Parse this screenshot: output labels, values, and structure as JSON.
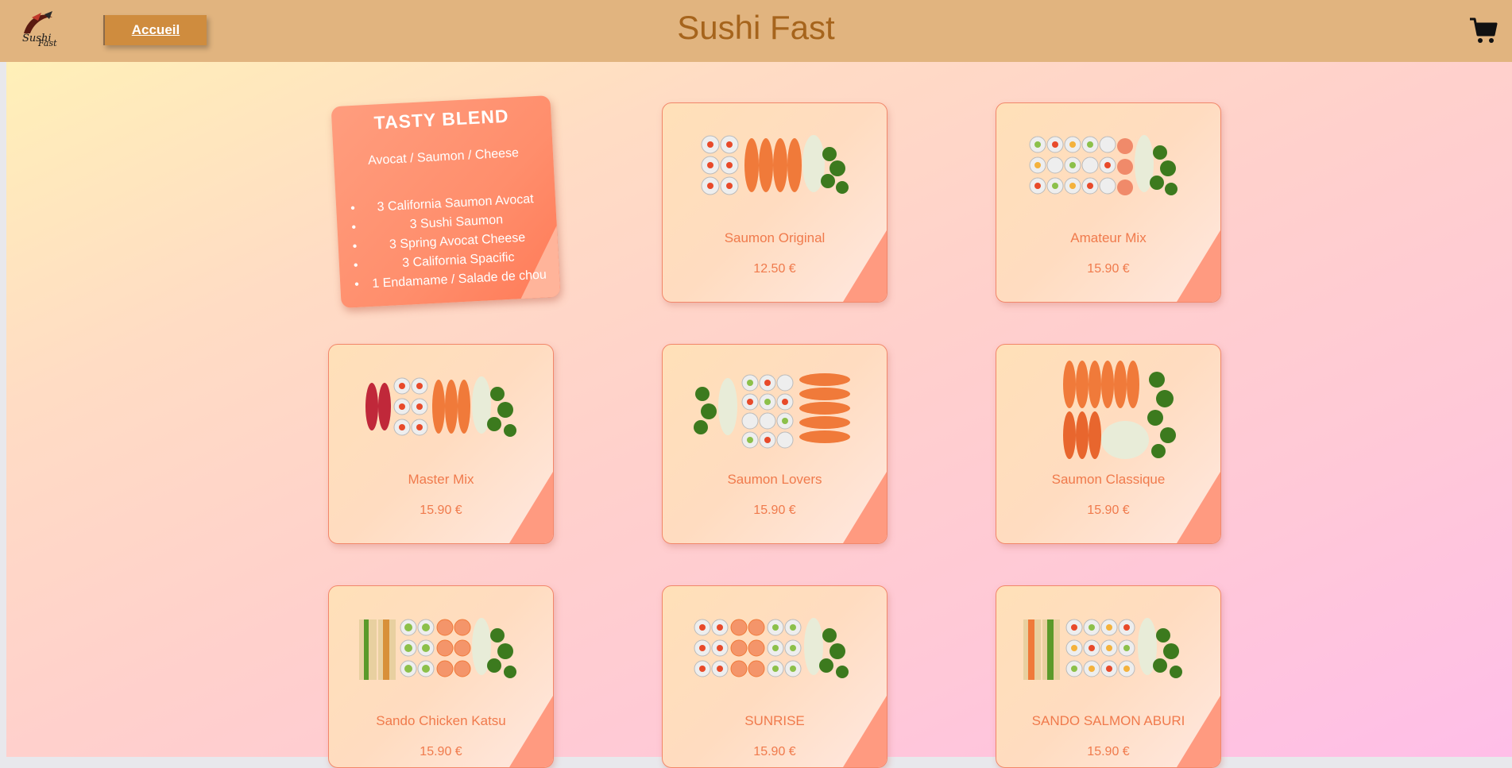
{
  "header": {
    "title": "Sushi Fast",
    "home_label": "Accueil",
    "logo_text": "SushiFast",
    "bg_color": "#e1b47f",
    "icons": [
      "logo-icon",
      "cart-icon"
    ]
  },
  "featured": {
    "title": "TASTY BLEND",
    "subtitle": "Avocat / Saumon / Cheese",
    "items": [
      "3 California Saumon Avocat",
      "3 Sushi Saumon",
      "3 Spring Avocat Cheese",
      "3 California Spacific",
      "1 Endamame / Salade de chou"
    ]
  },
  "products": [
    {
      "name": "Saumon Original",
      "price": "12.50 €"
    },
    {
      "name": "Amateur Mix",
      "price": "15.90 €"
    },
    {
      "name": "Master Mix",
      "price": "15.90 €"
    },
    {
      "name": "Saumon Lovers",
      "price": "15.90 €"
    },
    {
      "name": "Saumon Classique",
      "price": "15.90 €"
    },
    {
      "name": "Sando Chicken Katsu",
      "price": "15.90 €"
    },
    {
      "name": "SUNRISE",
      "price": "15.90 €"
    },
    {
      "name": "SANDO SALMON ABURI",
      "price": "15.90 €"
    }
  ],
  "colors": {
    "accent": "#f07a4c",
    "title": "#a6641c",
    "home_button": "#cf8c3e"
  }
}
